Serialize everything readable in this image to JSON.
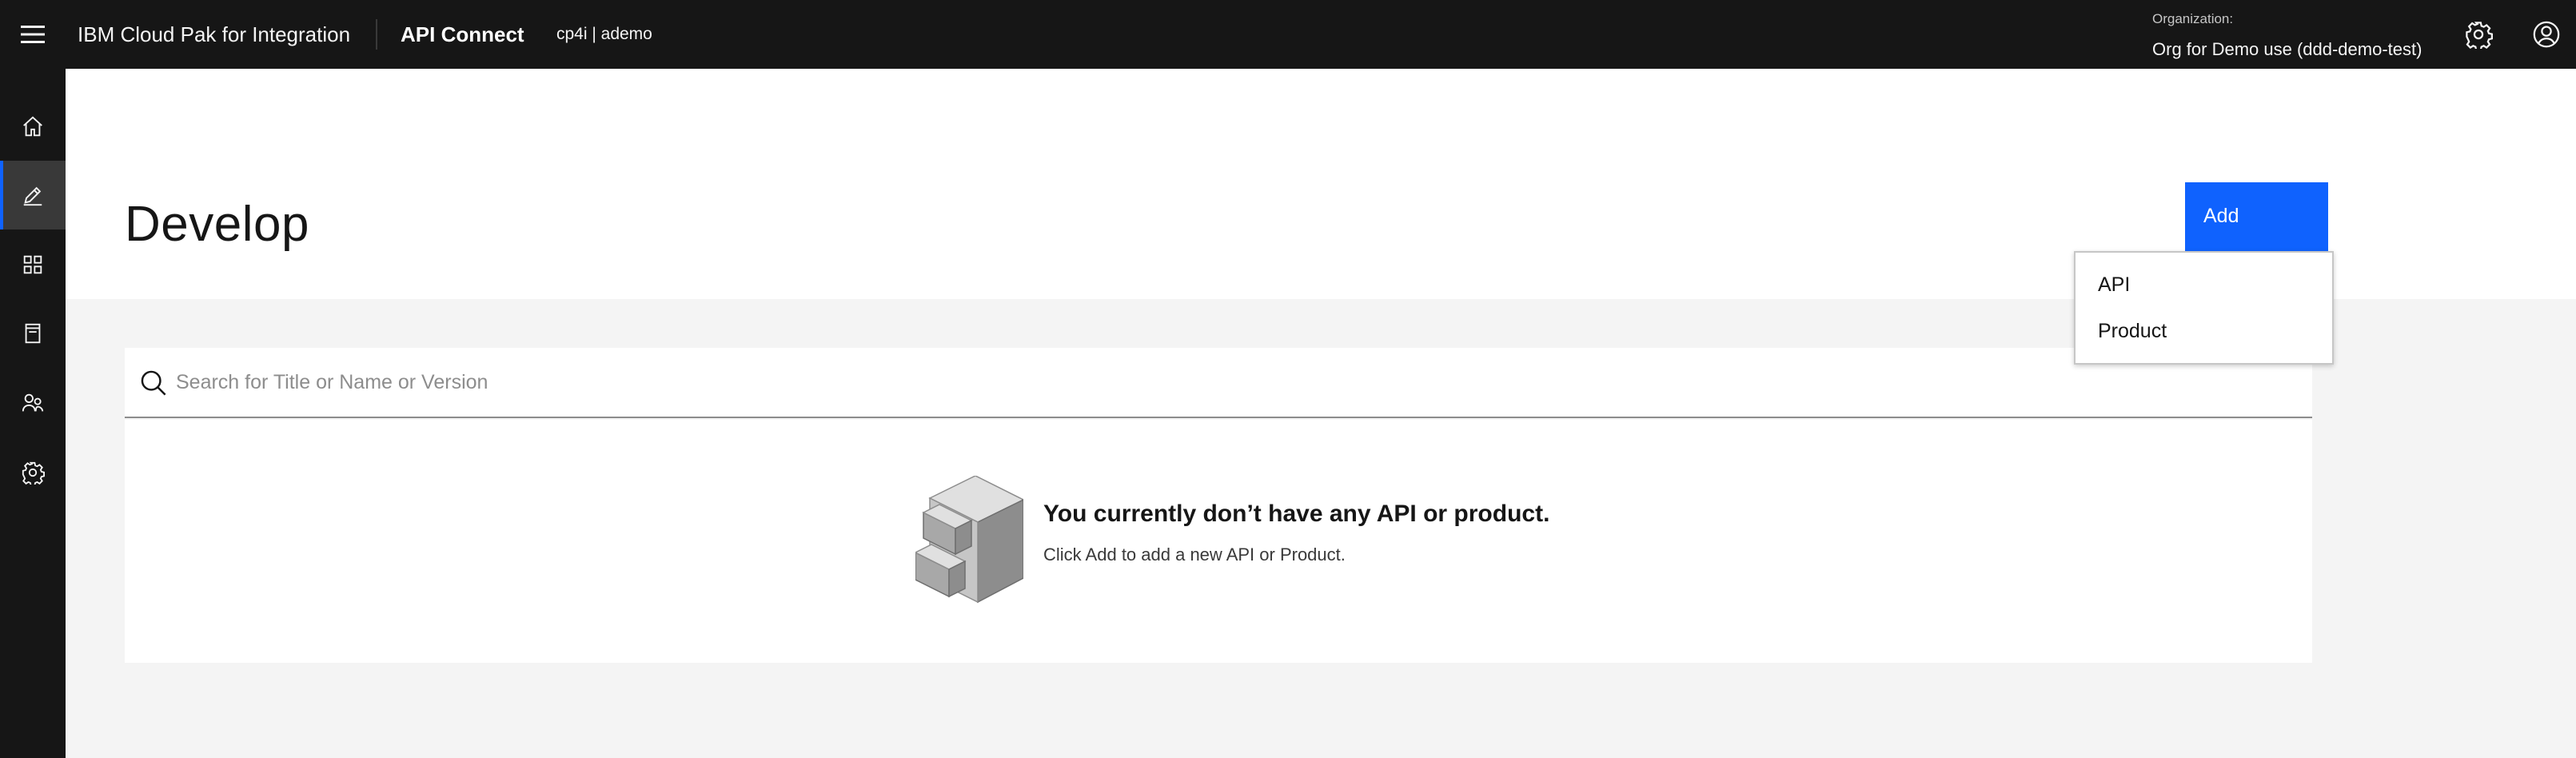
{
  "header": {
    "brand": "IBM Cloud Pak for Integration",
    "product": "API Connect",
    "instance": "cp4i | ademo",
    "org_label": "Organization:",
    "org_name": "Org for Demo use (ddd-demo-test)",
    "icons": [
      "menu-icon",
      "settings-icon",
      "user-avatar-icon"
    ]
  },
  "sidebar": {
    "items": [
      {
        "name": "home",
        "icon": "home-icon",
        "active": false
      },
      {
        "name": "develop",
        "icon": "edit-icon",
        "active": true
      },
      {
        "name": "manage",
        "icon": "apps-icon",
        "active": false
      },
      {
        "name": "catalog",
        "icon": "notebook-icon",
        "active": false
      },
      {
        "name": "members",
        "icon": "user-multiple-icon",
        "active": false
      },
      {
        "name": "settings",
        "icon": "settings-icon",
        "active": false
      }
    ]
  },
  "page": {
    "title": "Develop",
    "add_label": "Add"
  },
  "dropdown": {
    "items": [
      "API",
      "Product"
    ]
  },
  "search": {
    "placeholder": "Search for Title or Name or Version",
    "value": ""
  },
  "empty_state": {
    "title": "You currently don’t have any API or product.",
    "text": "Click Add to add a new API or Product.",
    "icon": "filing-cabinet-illustration"
  },
  "colors": {
    "header_bg": "#161616",
    "accent": "#0f62fe",
    "page_bg": "#f4f4f4"
  }
}
